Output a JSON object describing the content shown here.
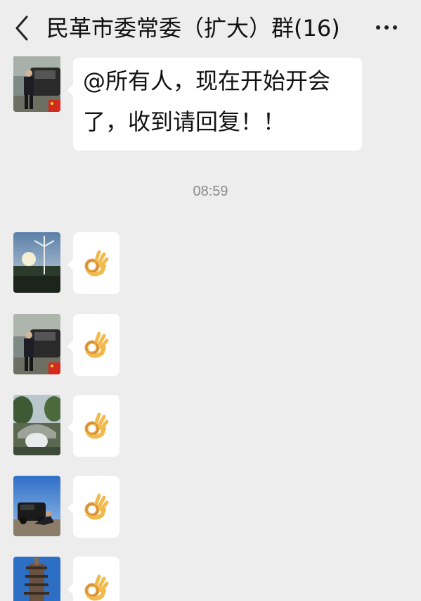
{
  "header": {
    "title": "民革市委常委（扩大）群(16)",
    "back_icon": "chevron-left-icon",
    "more_icon": "more-dots-icon"
  },
  "messages": [
    {
      "type": "text",
      "sender_avatar": "man-with-car-avatar",
      "text": "@所有人，现在开始开会了，收到请回复！！"
    },
    {
      "type": "timestamp",
      "text": "08:59"
    },
    {
      "type": "emoji",
      "sender_avatar": "wind-turbine-avatar",
      "emoji": "ok-hand-icon"
    },
    {
      "type": "emoji",
      "sender_avatar": "man-with-car-avatar",
      "emoji": "ok-hand-icon"
    },
    {
      "type": "emoji",
      "sender_avatar": "garden-bridge-avatar",
      "emoji": "ok-hand-icon"
    },
    {
      "type": "emoji",
      "sender_avatar": "person-with-suv-avatar",
      "emoji": "ok-hand-icon"
    },
    {
      "type": "emoji",
      "sender_avatar": "pagoda-avatar",
      "emoji": "ok-hand-icon"
    }
  ]
}
